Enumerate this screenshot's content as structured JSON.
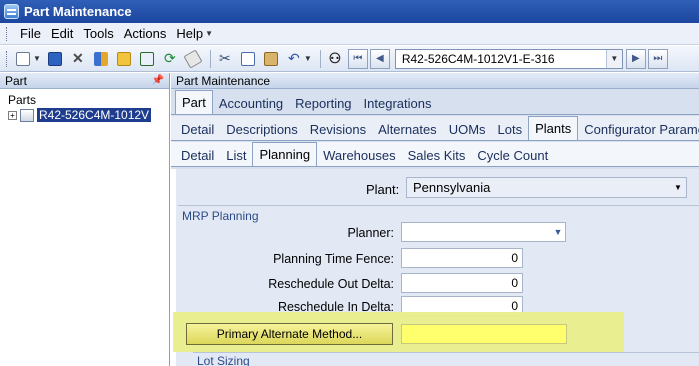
{
  "window": {
    "title": "Part Maintenance"
  },
  "menu": {
    "items": [
      "File",
      "Edit",
      "Tools",
      "Actions",
      "Help"
    ]
  },
  "toolbar": {
    "icons": [
      "new-icon",
      "save-icon",
      "delete-icon",
      "book-icon",
      "folder-icon",
      "attach-icon",
      "refresh-icon",
      "eraser-icon",
      "cut-icon",
      "copy-icon",
      "paste-icon",
      "undo-icon",
      "binoculars-icon",
      "first-icon",
      "prev-icon",
      "next-icon",
      "last-icon"
    ],
    "part_value": "R42-526C4M-1012V1-E-316"
  },
  "left_panel": {
    "header": "Part",
    "tree_root": "Parts",
    "tree_node": "R42-526C4M-1012V"
  },
  "right_panel": {
    "header": "Part Maintenance",
    "tabs_level1": [
      "Part",
      "Accounting",
      "Reporting",
      "Integrations"
    ],
    "tabs_level2": [
      "Detail",
      "Descriptions",
      "Revisions",
      "Alternates",
      "UOMs",
      "Lots",
      "Plants",
      "Configurator Parameter"
    ],
    "tabs_level3": [
      "Detail",
      "List",
      "Planning",
      "Warehouses",
      "Sales Kits",
      "Cycle Count"
    ],
    "active_level1": "Part",
    "active_level2": "Plants",
    "active_level3": "Planning"
  },
  "form": {
    "plant_label": "Plant:",
    "plant_value": "Pennsylvania",
    "group_title": "MRP Planning",
    "planner_label": "Planner:",
    "planner_value": "",
    "planning_time_fence_label": "Planning Time Fence:",
    "planning_time_fence_value": "0",
    "reschedule_out_label": "Reschedule Out Delta:",
    "reschedule_out_value": "0",
    "reschedule_in_label": "Reschedule In Delta:",
    "reschedule_in_value": "0",
    "primary_alt_button": "Primary Alternate Method...",
    "primary_alt_value": "",
    "lot_sizing_title": "Lot Sizing"
  },
  "colors": {
    "title_bar": "#1c469f",
    "highlight": "#e9ee8a",
    "field_yellow": "#ffff6e",
    "selection": "#1f3d8f"
  }
}
